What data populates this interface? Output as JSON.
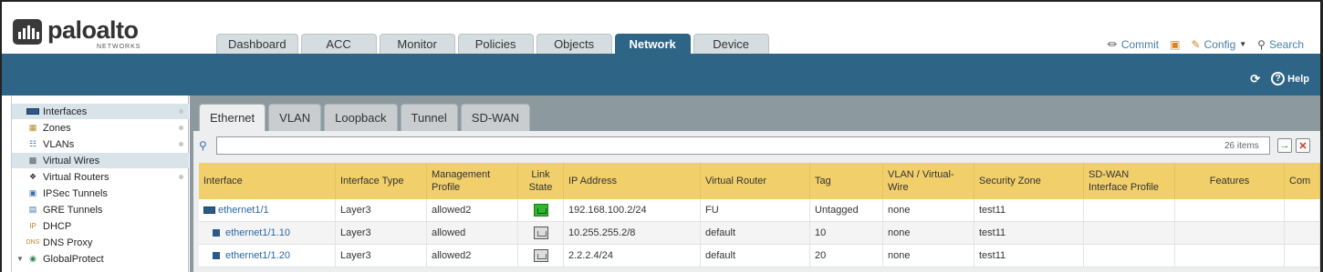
{
  "brand": {
    "name": "paloalto",
    "sub": "NETWORKS"
  },
  "top_tabs": [
    {
      "label": "Dashboard"
    },
    {
      "label": "ACC"
    },
    {
      "label": "Monitor"
    },
    {
      "label": "Policies"
    },
    {
      "label": "Objects"
    },
    {
      "label": "Network",
      "active": true
    },
    {
      "label": "Device"
    }
  ],
  "header_actions": {
    "commit": "Commit",
    "config": "Config",
    "search": "Search"
  },
  "band": {
    "help": "Help"
  },
  "sidebar": {
    "items": [
      {
        "label": "Interfaces",
        "icon": "interfaces-icon",
        "selected": true
      },
      {
        "label": "Zones",
        "icon": "zones-icon"
      },
      {
        "label": "VLANs",
        "icon": "vlans-icon"
      },
      {
        "label": "Virtual Wires",
        "icon": "virtual-wires-icon",
        "selected": true
      },
      {
        "label": "Virtual Routers",
        "icon": "virtual-routers-icon"
      },
      {
        "label": "IPSec Tunnels",
        "icon": "ipsec-tunnels-icon"
      },
      {
        "label": "GRE Tunnels",
        "icon": "gre-tunnels-icon"
      },
      {
        "label": "DHCP",
        "icon": "dhcp-icon"
      },
      {
        "label": "DNS Proxy",
        "icon": "dns-proxy-icon"
      },
      {
        "label": "GlobalProtect",
        "icon": "globalprotect-icon"
      }
    ]
  },
  "sub_tabs": [
    {
      "label": "Ethernet",
      "active": true
    },
    {
      "label": "VLAN"
    },
    {
      "label": "Loopback"
    },
    {
      "label": "Tunnel"
    },
    {
      "label": "SD-WAN"
    }
  ],
  "search": {
    "placeholder": "",
    "count": "26 items"
  },
  "table": {
    "columns": [
      "Interface",
      "Interface Type",
      "Management Profile",
      "Link State",
      "IP Address",
      "Virtual Router",
      "Tag",
      "VLAN / Virtual-Wire",
      "Security Zone",
      "SD-WAN Interface Profile",
      "Features",
      "Com"
    ],
    "rows": [
      {
        "interface": "ethernet1/1",
        "type": "Layer3",
        "mgmt": "allowed2",
        "link": "up",
        "ip": "192.168.100.2/24",
        "vr": "FU",
        "tag": "Untagged",
        "vlan": "none",
        "zone": "test11",
        "sdwan": "",
        "features": "",
        "comment": ""
      },
      {
        "interface": "ethernet1/1.10",
        "type": "Layer3",
        "mgmt": "allowed",
        "link": "down",
        "ip": "10.255.255.2/8",
        "vr": "default",
        "tag": "10",
        "vlan": "none",
        "zone": "test11",
        "sdwan": "",
        "features": "",
        "comment": ""
      },
      {
        "interface": "ethernet1/1.20",
        "type": "Layer3",
        "mgmt": "allowed2",
        "link": "down",
        "ip": "2.2.2.4/24",
        "vr": "default",
        "tag": "20",
        "vlan": "none",
        "zone": "test11",
        "sdwan": "",
        "features": "",
        "comment": ""
      }
    ]
  },
  "colors": {
    "brand_blue": "#2e6587",
    "header_row": "#f1cf6a",
    "link_up": "#2fb52f"
  }
}
